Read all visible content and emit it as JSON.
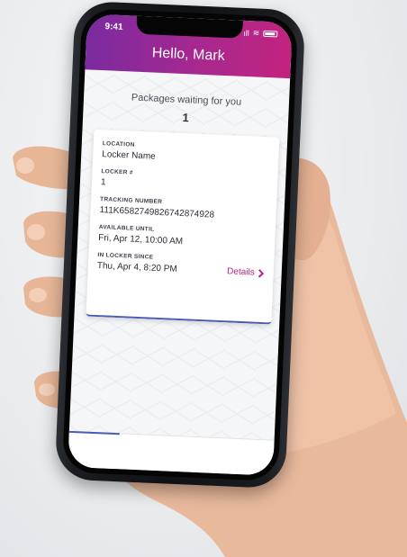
{
  "status": {
    "time": "9:41",
    "signal": "ıll",
    "wifi": "≋"
  },
  "header": {
    "title": "Hello, Mark"
  },
  "summary": {
    "waiting_label": "Packages waiting for you",
    "count": "1"
  },
  "card": {
    "fields": [
      {
        "label": "LOCATION",
        "value": "Locker Name"
      },
      {
        "label": "LOCKER #",
        "value": "1"
      },
      {
        "label": "TRACKING NUMBER",
        "value": "111K6582749826742874928"
      },
      {
        "label": "AVAILABLE UNTIL",
        "value": "Fri, Apr 12, 10:00 AM"
      },
      {
        "label": "IN LOCKER SINCE",
        "value": "Thu, Apr 4, 8:20 PM"
      }
    ],
    "details_label": "Details",
    "details_icon": "chevron-right-icon"
  },
  "colors": {
    "header_start": "#7b2aa0",
    "header_end": "#c3237e",
    "accent": "#b5257f",
    "card_border": "#4a5bb7"
  }
}
